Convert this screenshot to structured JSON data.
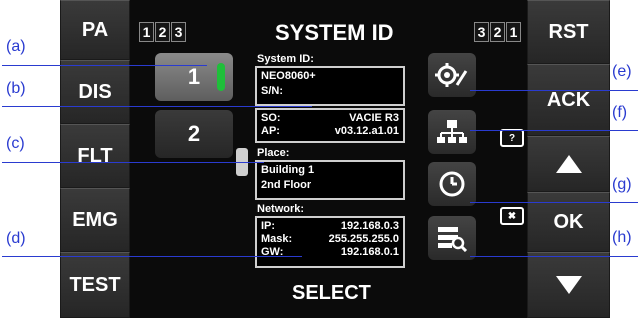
{
  "left_buttons": [
    "PA",
    "DIS",
    "FLT",
    "EMG",
    "TEST"
  ],
  "right_buttons": {
    "rst": "RST",
    "ack": "ACK",
    "ok": "OK"
  },
  "header": {
    "title": "SYSTEM ID",
    "left_digits": [
      "1",
      "2",
      "3"
    ],
    "right_digits": [
      "3",
      "2",
      "1"
    ]
  },
  "footer": {
    "select": "SELECT"
  },
  "zones": [
    "1",
    "2"
  ],
  "info": {
    "system_id_label": "System ID:",
    "system_id_value": "NEO8060+",
    "sn_label": "S/N:",
    "so_label": "SO:",
    "so_value": "VACIE R3",
    "ap_label": "AP:",
    "ap_value": "v03.12.a1.01",
    "place_label": "Place:",
    "place_line1": "Building 1",
    "place_line2": "2nd Floor",
    "network_label": "Network:",
    "ip_label": "IP:",
    "ip_value": "192.168.0.3",
    "mask_label": "Mask:",
    "mask_value": "255.255.255.0",
    "gw_label": "GW:",
    "gw_value": "192.168.0.1"
  },
  "callouts": [
    "(a)",
    "(b)",
    "(c)",
    "(d)",
    "(e)",
    "(f)",
    "(g)",
    "(h)"
  ],
  "key_icons": {
    "help": "?",
    "cancel": "✖"
  },
  "icons": [
    "settings-icon",
    "network-tree-icon",
    "clock-icon",
    "search-list-icon",
    "up-arrow-icon",
    "down-arrow-icon"
  ],
  "colors": {
    "zone_indicator": "#1fbf3a",
    "callout": "#2a3bd0"
  }
}
